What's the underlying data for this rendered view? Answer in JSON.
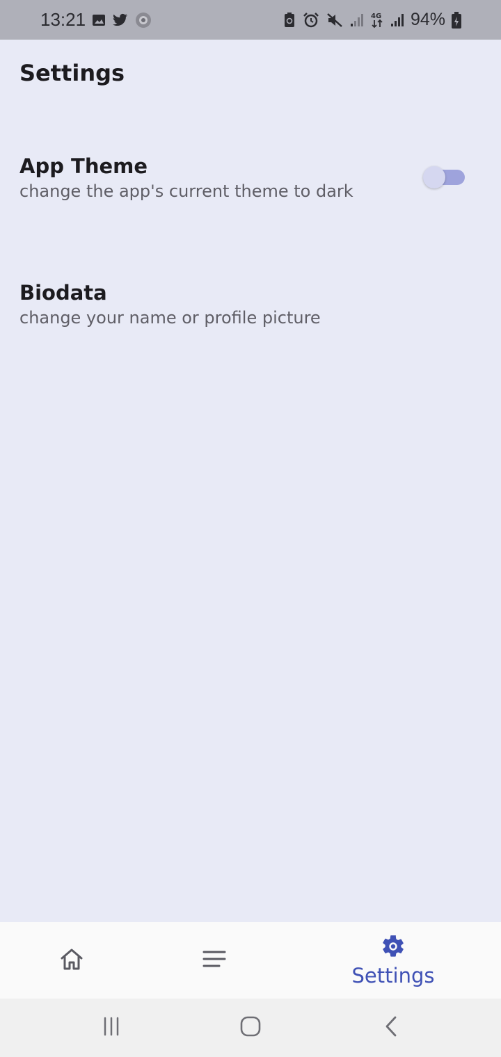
{
  "status_bar": {
    "time": "13:21",
    "battery_percent": "94%",
    "left_icons": [
      "image-icon",
      "twitter-icon",
      "app-badge-icon"
    ],
    "right_icons": [
      "battery-saver-icon",
      "alarm-icon",
      "mute-icon",
      "signal-icon",
      "4g-data-icon",
      "signal-icon",
      "battery-charging-icon"
    ]
  },
  "page": {
    "title": "Settings"
  },
  "settings": {
    "theme": {
      "title": "App Theme",
      "subtitle": "change the app's current theme to dark",
      "toggle_on": false
    },
    "biodata": {
      "title": "Biodata",
      "subtitle": "change your name or profile picture"
    }
  },
  "bottom_nav": {
    "items": [
      {
        "icon": "home-icon",
        "label": ""
      },
      {
        "icon": "list-icon",
        "label": ""
      },
      {
        "icon": "gear-icon",
        "label": "Settings",
        "active": true
      }
    ]
  },
  "colors": {
    "background": "#e8eaf6",
    "accent": "#3f51b5",
    "status_bar": "#afb0b9"
  }
}
